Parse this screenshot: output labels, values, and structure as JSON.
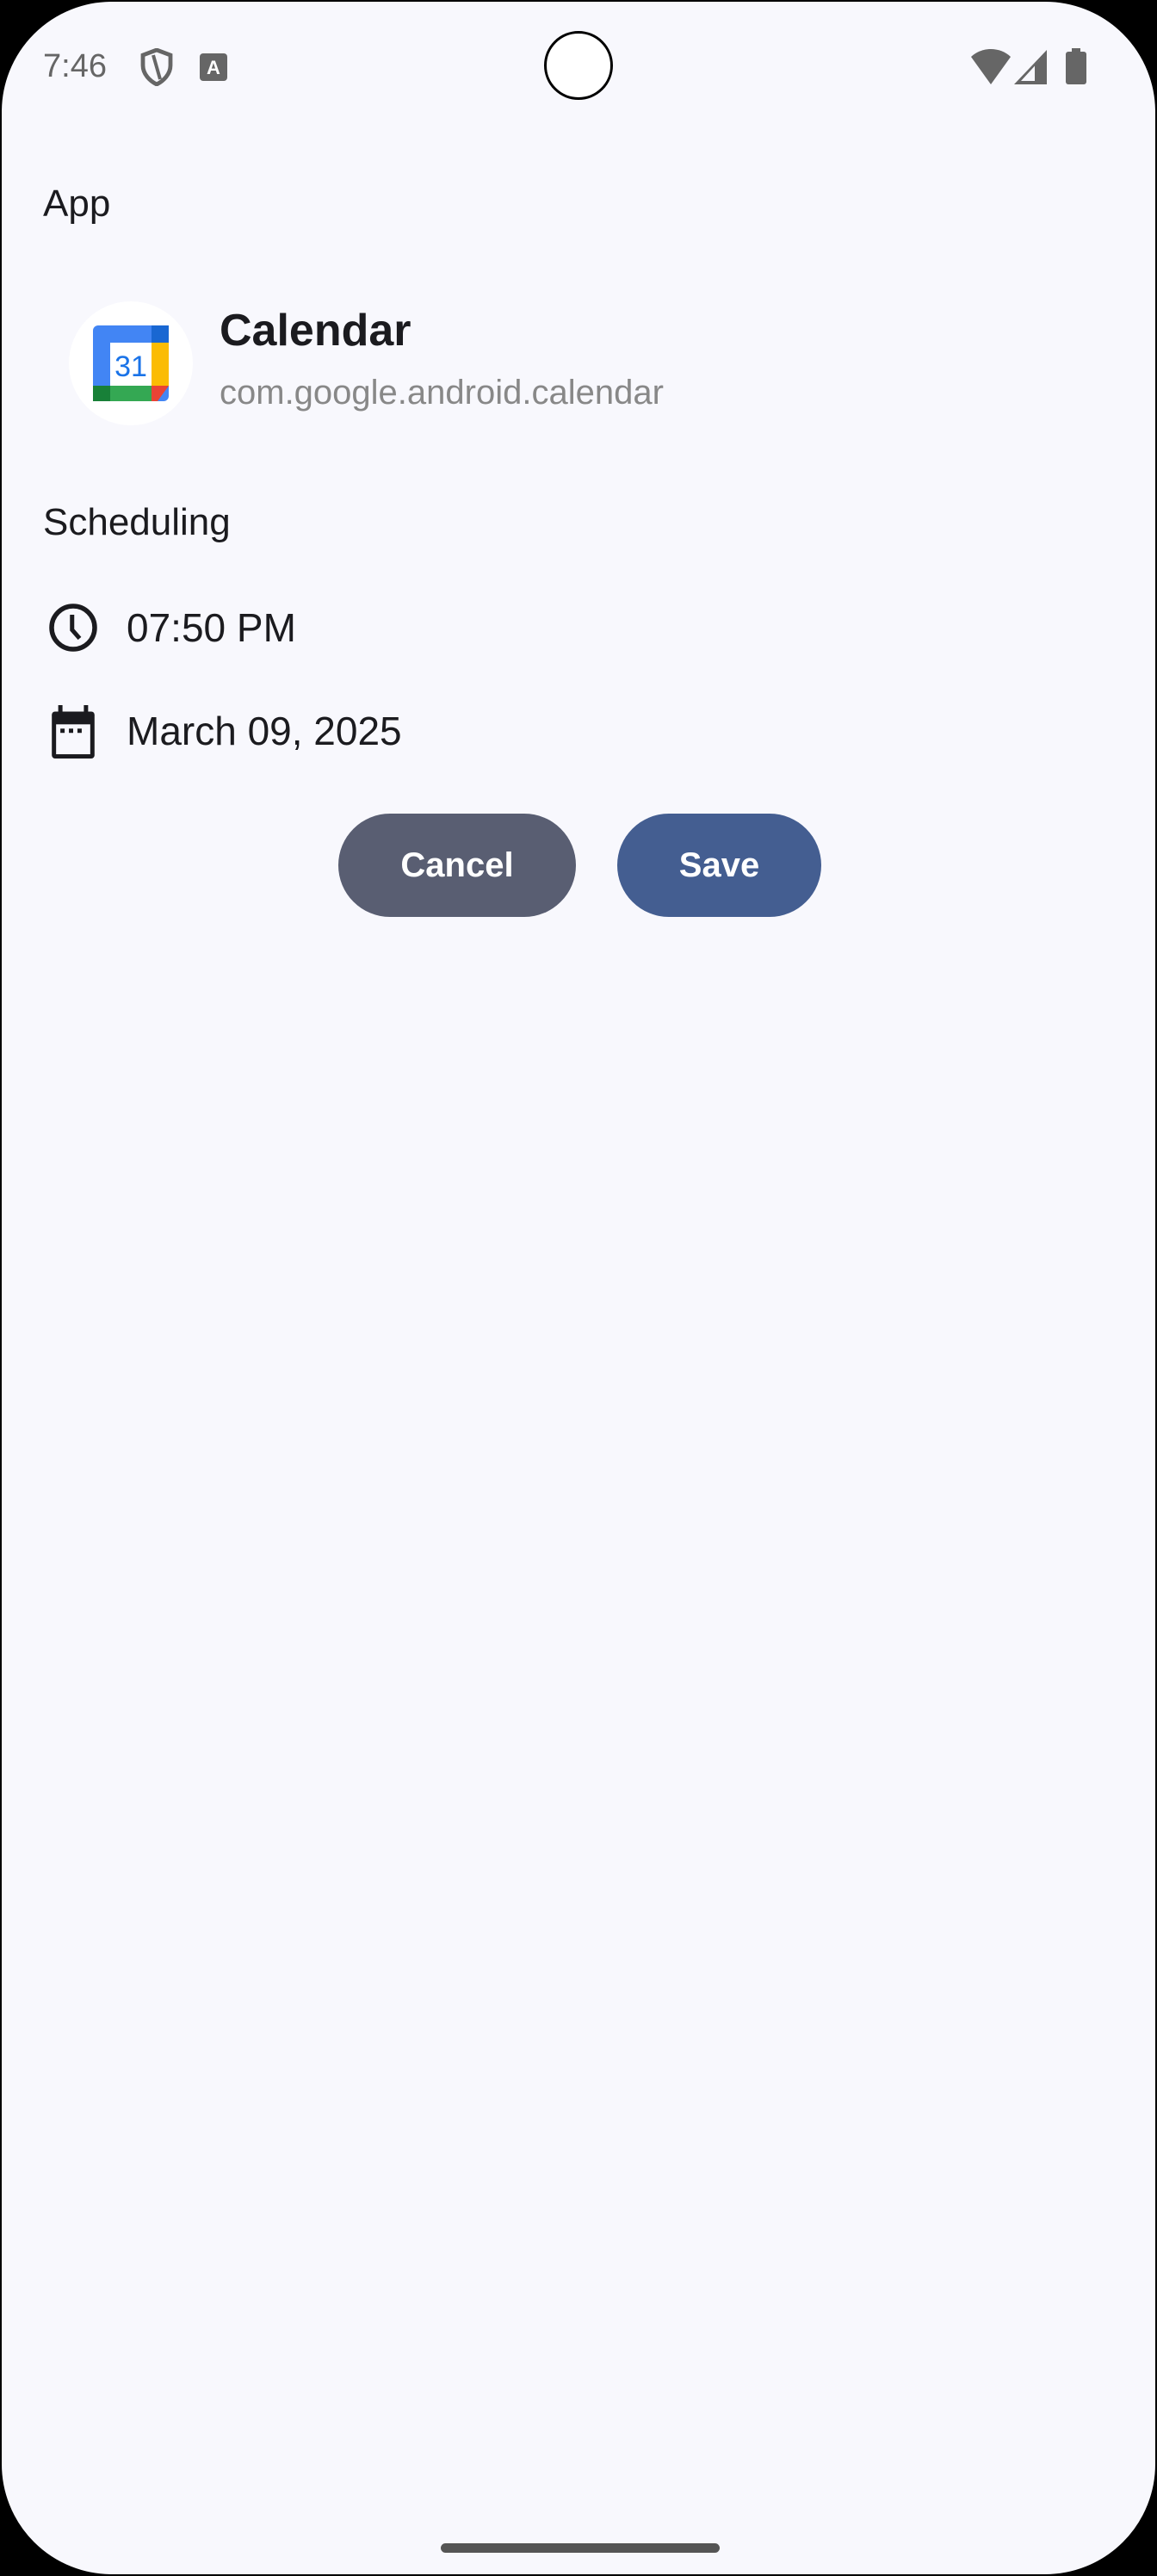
{
  "status_bar": {
    "time": "7:46",
    "icons": [
      "shield-icon",
      "font-a-icon",
      "wifi-icon",
      "signal-icon",
      "battery-icon"
    ]
  },
  "app_section": {
    "title": "App",
    "app_name": "Calendar",
    "package": "com.google.android.calendar",
    "icon_label": "31"
  },
  "scheduling": {
    "title": "Scheduling",
    "time": "07:50 PM",
    "date": "March 09, 2025"
  },
  "actions": {
    "cancel_label": "Cancel",
    "save_label": "Save"
  },
  "colors": {
    "cancel": "#595e72",
    "save": "#445e91",
    "background": "#f8f8fd"
  }
}
